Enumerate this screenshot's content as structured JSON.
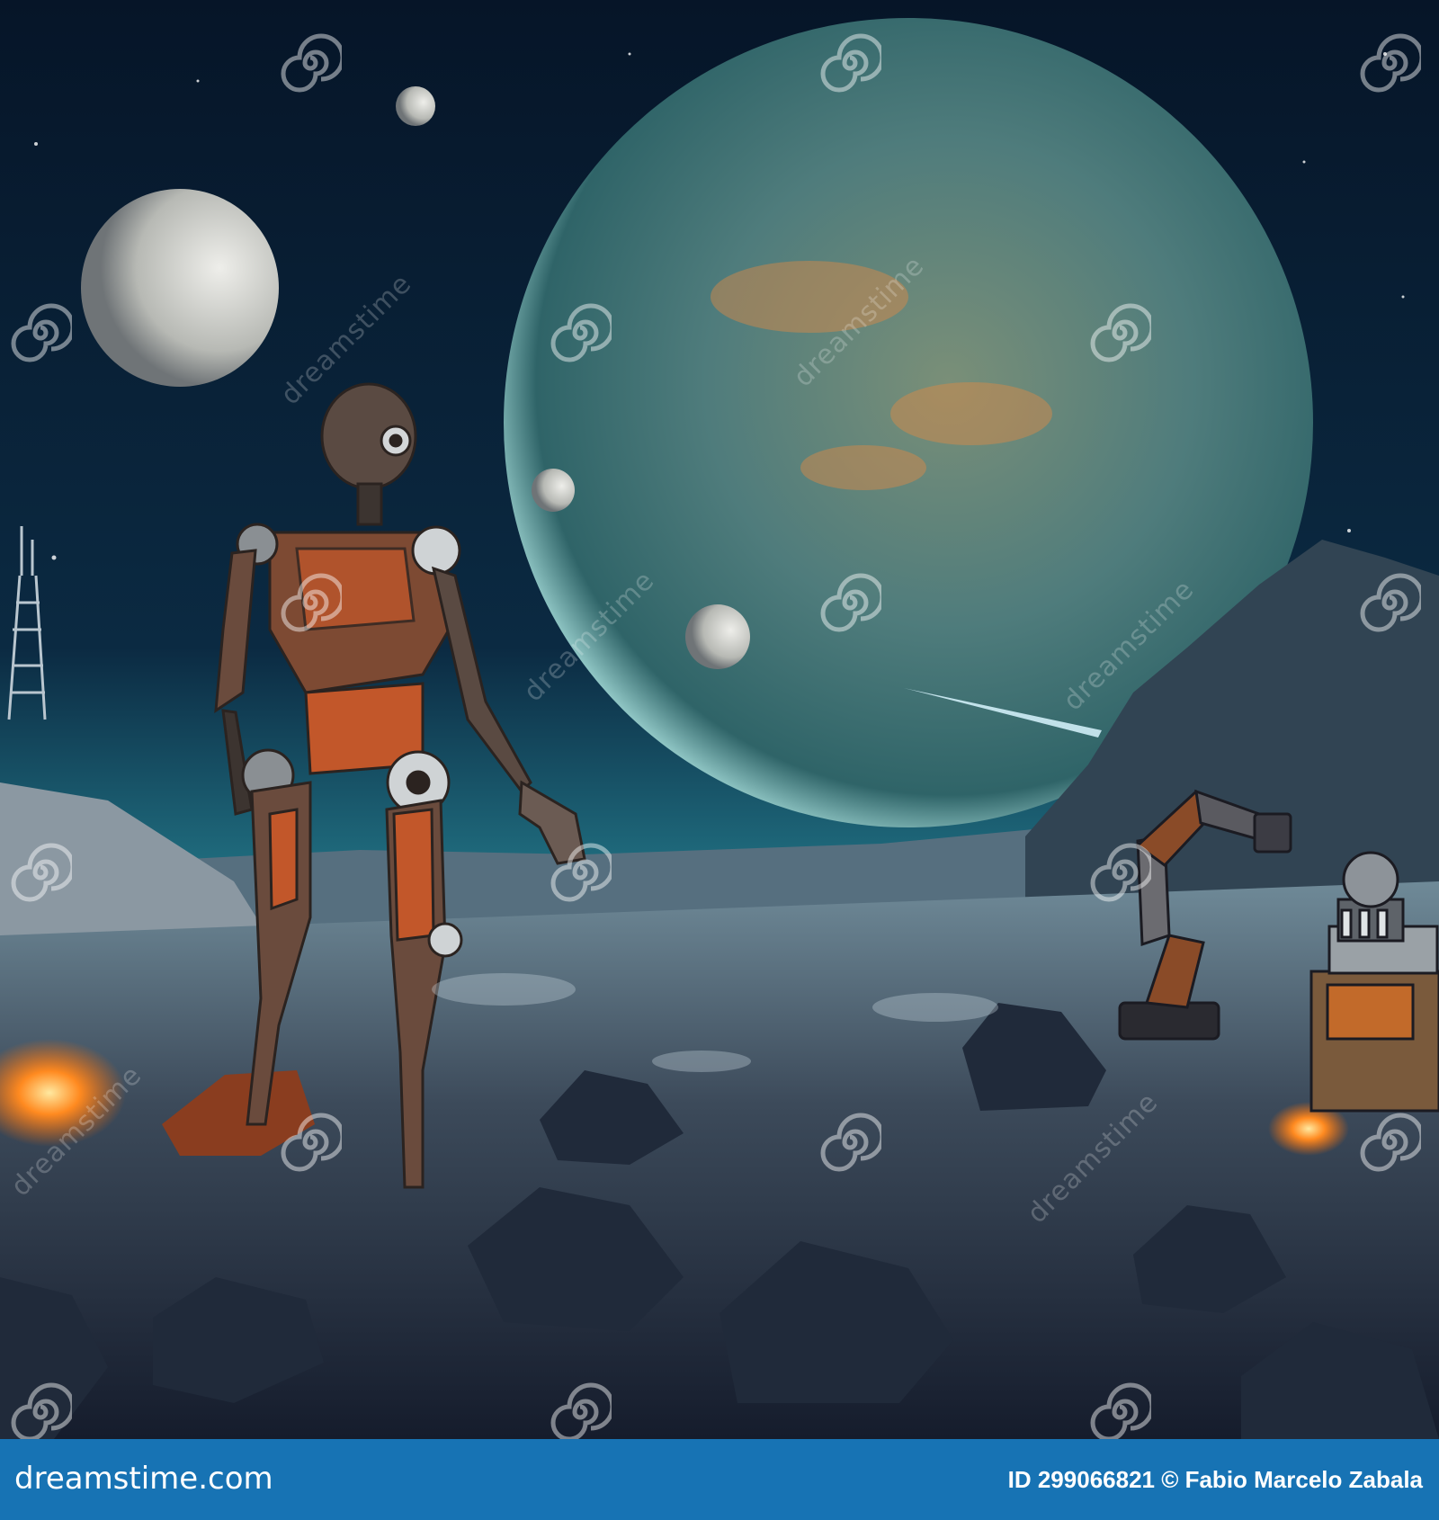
{
  "watermark": {
    "text": "dreamstime"
  },
  "footer": {
    "brand": "dreamstime.com",
    "credit": "ID 299066821 © Fabio Marcelo Zabala"
  },
  "colors": {
    "sky_top": "#061528",
    "sky_horizon": "#1f6b7d",
    "planet_core": "#5f8f89",
    "planet_glow": "#bff6f2",
    "robot_metal": "#5a4a42",
    "robot_orange": "#c2572a",
    "footer_bg": "#1773b4"
  },
  "scene": {
    "subjects": [
      "humanoid-robot",
      "giant-planet",
      "small-moons",
      "robotic-arm",
      "machine-tower",
      "rocky-terrain",
      "comet",
      "lattice-tower"
    ]
  }
}
